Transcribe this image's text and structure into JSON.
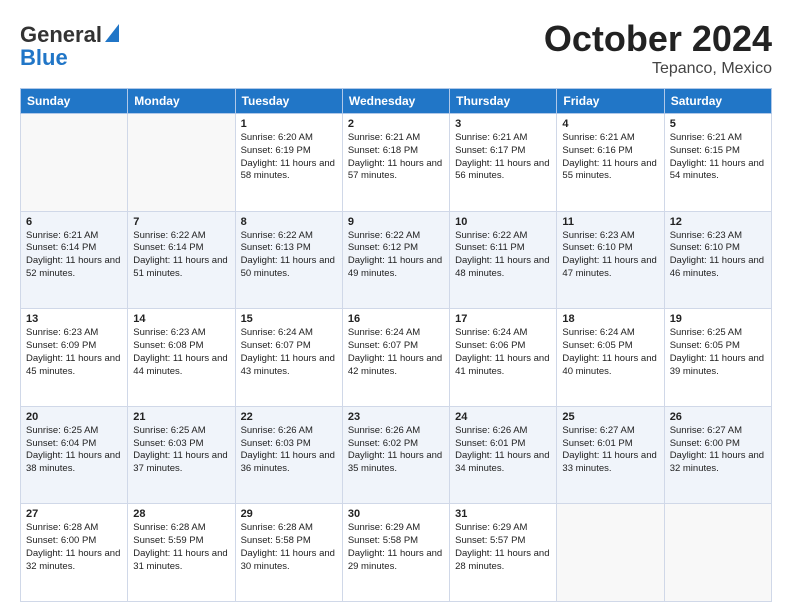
{
  "header": {
    "logo_text_general": "General",
    "logo_text_blue": "Blue",
    "title": "October 2024",
    "subtitle": "Tepanco, Mexico"
  },
  "weekdays": [
    "Sunday",
    "Monday",
    "Tuesday",
    "Wednesday",
    "Thursday",
    "Friday",
    "Saturday"
  ],
  "weeks": [
    [
      {
        "day": "",
        "sunrise": "",
        "sunset": "",
        "daylight": ""
      },
      {
        "day": "",
        "sunrise": "",
        "sunset": "",
        "daylight": ""
      },
      {
        "day": "1",
        "sunrise": "Sunrise: 6:20 AM",
        "sunset": "Sunset: 6:19 PM",
        "daylight": "Daylight: 11 hours and 58 minutes."
      },
      {
        "day": "2",
        "sunrise": "Sunrise: 6:21 AM",
        "sunset": "Sunset: 6:18 PM",
        "daylight": "Daylight: 11 hours and 57 minutes."
      },
      {
        "day": "3",
        "sunrise": "Sunrise: 6:21 AM",
        "sunset": "Sunset: 6:17 PM",
        "daylight": "Daylight: 11 hours and 56 minutes."
      },
      {
        "day": "4",
        "sunrise": "Sunrise: 6:21 AM",
        "sunset": "Sunset: 6:16 PM",
        "daylight": "Daylight: 11 hours and 55 minutes."
      },
      {
        "day": "5",
        "sunrise": "Sunrise: 6:21 AM",
        "sunset": "Sunset: 6:15 PM",
        "daylight": "Daylight: 11 hours and 54 minutes."
      }
    ],
    [
      {
        "day": "6",
        "sunrise": "Sunrise: 6:21 AM",
        "sunset": "Sunset: 6:14 PM",
        "daylight": "Daylight: 11 hours and 52 minutes."
      },
      {
        "day": "7",
        "sunrise": "Sunrise: 6:22 AM",
        "sunset": "Sunset: 6:14 PM",
        "daylight": "Daylight: 11 hours and 51 minutes."
      },
      {
        "day": "8",
        "sunrise": "Sunrise: 6:22 AM",
        "sunset": "Sunset: 6:13 PM",
        "daylight": "Daylight: 11 hours and 50 minutes."
      },
      {
        "day": "9",
        "sunrise": "Sunrise: 6:22 AM",
        "sunset": "Sunset: 6:12 PM",
        "daylight": "Daylight: 11 hours and 49 minutes."
      },
      {
        "day": "10",
        "sunrise": "Sunrise: 6:22 AM",
        "sunset": "Sunset: 6:11 PM",
        "daylight": "Daylight: 11 hours and 48 minutes."
      },
      {
        "day": "11",
        "sunrise": "Sunrise: 6:23 AM",
        "sunset": "Sunset: 6:10 PM",
        "daylight": "Daylight: 11 hours and 47 minutes."
      },
      {
        "day": "12",
        "sunrise": "Sunrise: 6:23 AM",
        "sunset": "Sunset: 6:10 PM",
        "daylight": "Daylight: 11 hours and 46 minutes."
      }
    ],
    [
      {
        "day": "13",
        "sunrise": "Sunrise: 6:23 AM",
        "sunset": "Sunset: 6:09 PM",
        "daylight": "Daylight: 11 hours and 45 minutes."
      },
      {
        "day": "14",
        "sunrise": "Sunrise: 6:23 AM",
        "sunset": "Sunset: 6:08 PM",
        "daylight": "Daylight: 11 hours and 44 minutes."
      },
      {
        "day": "15",
        "sunrise": "Sunrise: 6:24 AM",
        "sunset": "Sunset: 6:07 PM",
        "daylight": "Daylight: 11 hours and 43 minutes."
      },
      {
        "day": "16",
        "sunrise": "Sunrise: 6:24 AM",
        "sunset": "Sunset: 6:07 PM",
        "daylight": "Daylight: 11 hours and 42 minutes."
      },
      {
        "day": "17",
        "sunrise": "Sunrise: 6:24 AM",
        "sunset": "Sunset: 6:06 PM",
        "daylight": "Daylight: 11 hours and 41 minutes."
      },
      {
        "day": "18",
        "sunrise": "Sunrise: 6:24 AM",
        "sunset": "Sunset: 6:05 PM",
        "daylight": "Daylight: 11 hours and 40 minutes."
      },
      {
        "day": "19",
        "sunrise": "Sunrise: 6:25 AM",
        "sunset": "Sunset: 6:05 PM",
        "daylight": "Daylight: 11 hours and 39 minutes."
      }
    ],
    [
      {
        "day": "20",
        "sunrise": "Sunrise: 6:25 AM",
        "sunset": "Sunset: 6:04 PM",
        "daylight": "Daylight: 11 hours and 38 minutes."
      },
      {
        "day": "21",
        "sunrise": "Sunrise: 6:25 AM",
        "sunset": "Sunset: 6:03 PM",
        "daylight": "Daylight: 11 hours and 37 minutes."
      },
      {
        "day": "22",
        "sunrise": "Sunrise: 6:26 AM",
        "sunset": "Sunset: 6:03 PM",
        "daylight": "Daylight: 11 hours and 36 minutes."
      },
      {
        "day": "23",
        "sunrise": "Sunrise: 6:26 AM",
        "sunset": "Sunset: 6:02 PM",
        "daylight": "Daylight: 11 hours and 35 minutes."
      },
      {
        "day": "24",
        "sunrise": "Sunrise: 6:26 AM",
        "sunset": "Sunset: 6:01 PM",
        "daylight": "Daylight: 11 hours and 34 minutes."
      },
      {
        "day": "25",
        "sunrise": "Sunrise: 6:27 AM",
        "sunset": "Sunset: 6:01 PM",
        "daylight": "Daylight: 11 hours and 33 minutes."
      },
      {
        "day": "26",
        "sunrise": "Sunrise: 6:27 AM",
        "sunset": "Sunset: 6:00 PM",
        "daylight": "Daylight: 11 hours and 32 minutes."
      }
    ],
    [
      {
        "day": "27",
        "sunrise": "Sunrise: 6:28 AM",
        "sunset": "Sunset: 6:00 PM",
        "daylight": "Daylight: 11 hours and 32 minutes."
      },
      {
        "day": "28",
        "sunrise": "Sunrise: 6:28 AM",
        "sunset": "Sunset: 5:59 PM",
        "daylight": "Daylight: 11 hours and 31 minutes."
      },
      {
        "day": "29",
        "sunrise": "Sunrise: 6:28 AM",
        "sunset": "Sunset: 5:58 PM",
        "daylight": "Daylight: 11 hours and 30 minutes."
      },
      {
        "day": "30",
        "sunrise": "Sunrise: 6:29 AM",
        "sunset": "Sunset: 5:58 PM",
        "daylight": "Daylight: 11 hours and 29 minutes."
      },
      {
        "day": "31",
        "sunrise": "Sunrise: 6:29 AM",
        "sunset": "Sunset: 5:57 PM",
        "daylight": "Daylight: 11 hours and 28 minutes."
      },
      {
        "day": "",
        "sunrise": "",
        "sunset": "",
        "daylight": ""
      },
      {
        "day": "",
        "sunrise": "",
        "sunset": "",
        "daylight": ""
      }
    ]
  ]
}
